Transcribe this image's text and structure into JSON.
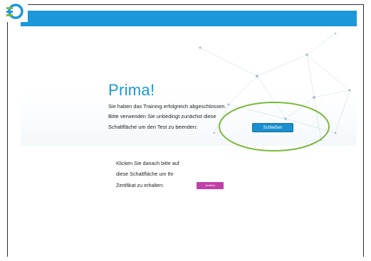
{
  "header": {
    "logo_icon": "training-logo-icon",
    "bar_color": "#1a98d8"
  },
  "main": {
    "title": "Prima!",
    "paragraph_lines": [
      "Sie haben das Training erfolgreich abgeschlossen.",
      "Bitte verwenden Sie unbedingt zunächst diese",
      "Schaltfläche um den Test zu beenden:"
    ],
    "close_button_label": "Schließen",
    "certificate_lines": [
      "Klicken Sie danach bitte auf",
      "diese Schaltfläche um Ihr",
      "Zertifikat zu erhalten:"
    ],
    "certificate_button_label": "Zertifikat"
  },
  "colors": {
    "accent": "#1a98d8",
    "highlight_ellipse": "#7cb83c",
    "certificate_button": "#c040a8"
  }
}
